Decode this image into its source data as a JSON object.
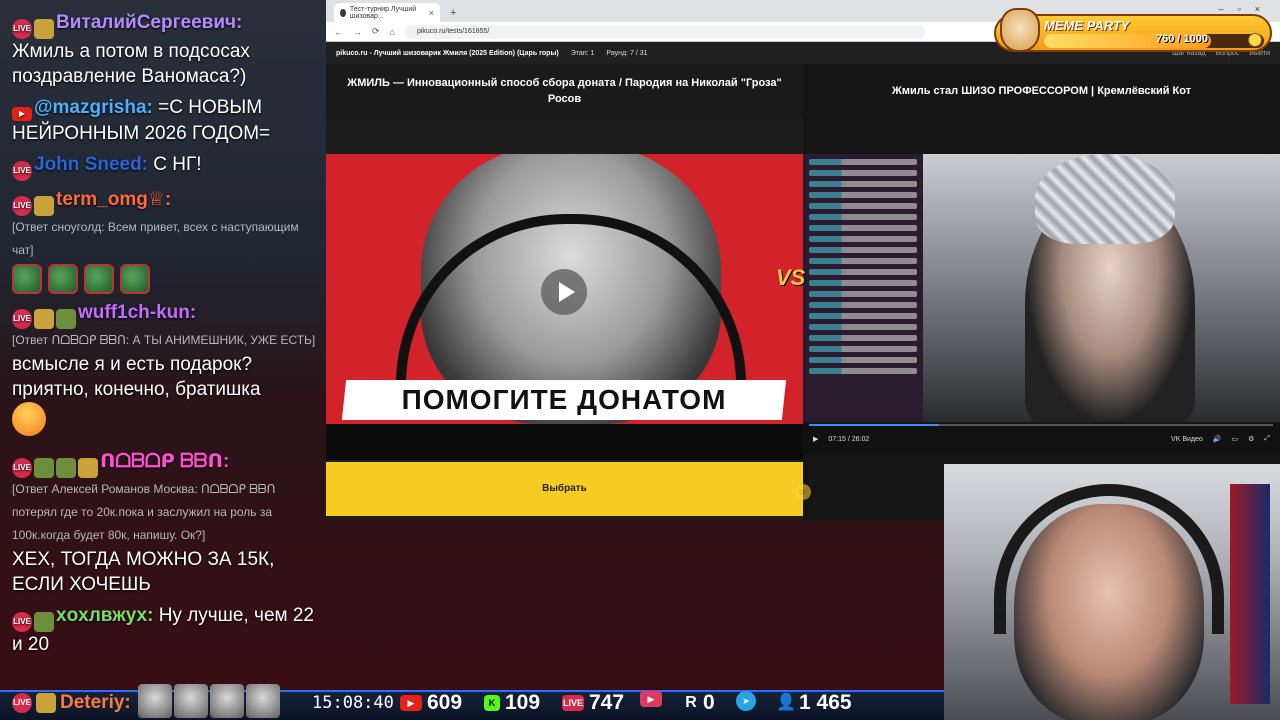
{
  "chat": {
    "messages": [
      {
        "nick": "ВиталийСергеевич:",
        "nick_color": "#b48cff",
        "text": "",
        "badges": [
          "live",
          "emoji2"
        ]
      },
      {
        "nick": "",
        "nick_color": "#ffffff",
        "text": "Жмиль а потом в подсосах поздравление Ваномаса?)",
        "bold_lead": "Жмиль"
      },
      {
        "nick": "@mazgrisha:",
        "nick_color": "#4fb0ff",
        "text": "=С НОВЫМ НЕЙРОННЫМ 2026 ГОДОМ=",
        "badges": [
          "yt"
        ]
      },
      {
        "nick": "John Sneed:",
        "nick_color": "#2c63d9",
        "text": "С НГ!",
        "badges": [
          "live"
        ]
      },
      {
        "nick": "term_omg♕:",
        "nick_color": "#ff6a3d",
        "text": "",
        "badges": [
          "live",
          "emoji2"
        ]
      },
      {
        "reply": "[Ответ сноуголд: Всем привет, всех с наступающим чат]"
      },
      {
        "emotes": 4
      },
      {
        "nick": "wuff1ch-kun:",
        "nick_color": "#c56bff",
        "text": "",
        "badges": [
          "live",
          "emoji2",
          "emoji"
        ]
      },
      {
        "reply": "[Ответ ᑎᗝᗷᗝᑭ ᗷᗷᑎ: А ТЫ АНИМЕШНИК, УЖЕ ЕСТЬ]"
      },
      {
        "nick": "",
        "nick_color": "#ffffff",
        "text": "всмысле я и есть подарок? приятно, конечно, братишка",
        "face": true
      },
      {
        "nick": "ᑎᗝᗷᗝᑭ ᗷᗷᑎ:",
        "nick_color": "#ff4fd0",
        "text": "",
        "badges": [
          "live",
          "emoji",
          "emoji",
          "emoji2"
        ]
      },
      {
        "reply": "[Ответ Алексей Романов Москва: ᑎᗝᗷᗝᑭ ᗷᗷᑎ потерял где то 20к.пока и заслужил на роль за 100к.когда будет 80к, напишу. Ок?]"
      },
      {
        "nick": "",
        "nick_color": "#ffffff",
        "text": "ХЕХ, ТОГДА МОЖНО ЗА 15К, ЕСЛИ ХОЧЕШЬ"
      },
      {
        "nick": "xoxлвжух:",
        "nick_color": "#7ddc6b",
        "text": "Ну лучше, чем 22 и 20",
        "badges": [
          "live",
          "emoji"
        ]
      }
    ],
    "bottom_nick": "Deteriy:"
  },
  "browser": {
    "tab_title": "Тест-турнир Лучший шизовар...",
    "url": "pikuco.ru/tests/161855/",
    "site_title": "pikuco.ru - Лучший шизоварик Жмиля (2025 Edition) (Царь горы)",
    "stage": "Этап: 1",
    "round": "Раунд: 7 / 31",
    "site_links": [
      "Шаг назад",
      "Вопрос",
      "Выйти"
    ]
  },
  "left_card": {
    "title": "ЖМИЛЬ — Инновационный способ сбора доната / Пародия на Николай \"Гроза\" Росов",
    "banner": "ПОМОГИТЕ ДОНАТОМ",
    "select_label": "Выбрать"
  },
  "right_card": {
    "title": "Жмиль стал ШИЗО ПРОФЕССОРОМ | Кремлёвский Кот",
    "time": "07:15 / 26:02",
    "provider": "VK Видео",
    "progress": 0.28
  },
  "vs_label": "VS",
  "meme_party": {
    "title": "MEME PARTY",
    "value": "760 / 1000",
    "fill": 0.76
  },
  "stats": {
    "clock": "15:08:40",
    "youtube": "609",
    "kick": "109",
    "live": "747",
    "rutube": "0",
    "r": "0",
    "telegram": "1 465"
  },
  "colors": {
    "select_yellow": "#f6cc22",
    "accent_blue": "#2d6cff",
    "thumb_red": "#d3232a"
  }
}
